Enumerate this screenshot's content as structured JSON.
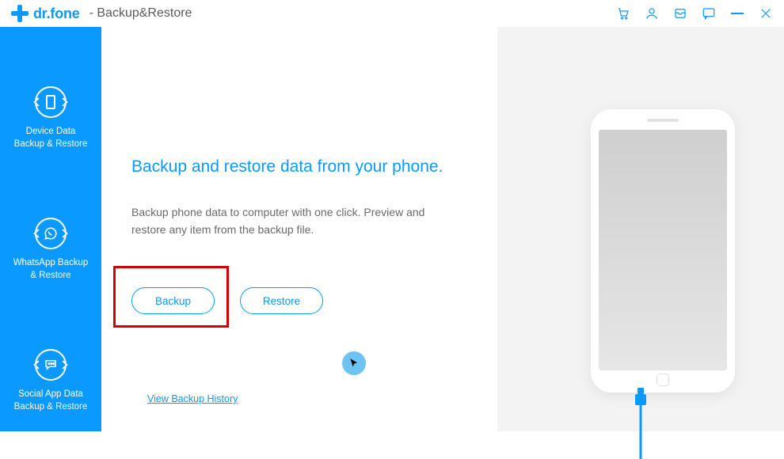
{
  "colors": {
    "accent": "#0a99ff",
    "highlight": "#d40000",
    "text_muted": "#6a6a6a"
  },
  "titlebar": {
    "brand": "dr.fone",
    "suffix": "- Backup&Restore",
    "icons": {
      "cart": "cart-icon",
      "account": "account-icon",
      "inbox": "inbox-icon",
      "feedback": "feedback-icon",
      "minimize": "minimize-icon",
      "close": "close-icon"
    }
  },
  "sidebar": {
    "items": [
      {
        "line1": "Device Data",
        "line2": "Backup &  Restore",
        "icon": "device-data-icon"
      },
      {
        "line1": "WhatsApp Backup",
        "line2": "&  Restore",
        "icon": "whatsapp-backup-icon"
      },
      {
        "line1": "Social App Data",
        "line2": "Backup &  Restore",
        "icon": "social-app-icon"
      }
    ]
  },
  "main": {
    "heading": "Backup and restore data from your phone.",
    "description": "Backup phone data to computer with one click. Preview and restore any item from the backup file.",
    "buttons": {
      "backup": "Backup",
      "restore": "Restore"
    },
    "history_link": "View Backup History"
  }
}
